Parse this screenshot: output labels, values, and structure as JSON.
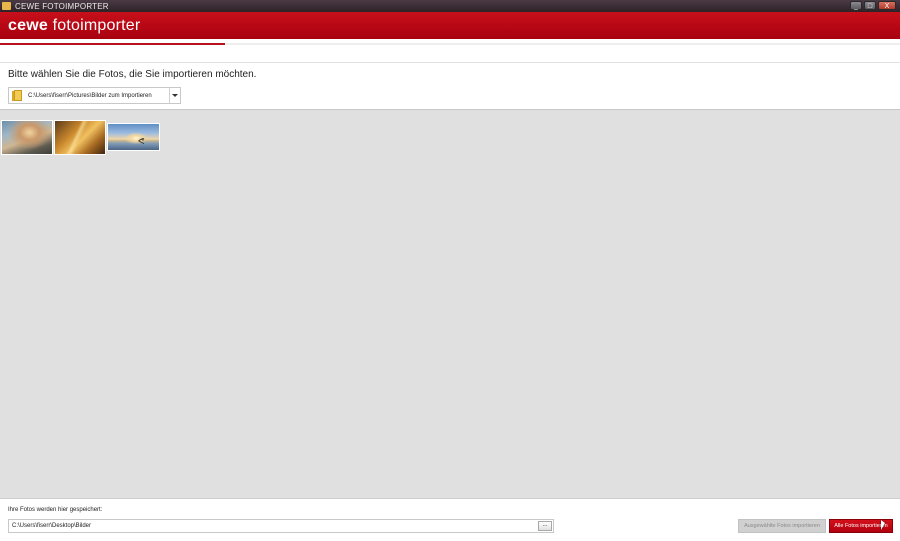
{
  "window": {
    "title": "CEWE FOTOIMPORTER",
    "controls": [
      "_",
      "□",
      "X"
    ]
  },
  "brand": {
    "bold": "cewe",
    "light": "fotoimporter",
    "accent_color": "#b8101c"
  },
  "import_progress": 0.25,
  "source": {
    "prompt": "Bitte wählen Sie die Fotos, die Sie importieren möchten.",
    "folder_path": "C:\\Users\\fiserr\\Pictures\\Bilder zum Importieren"
  },
  "thumbnails": [
    {
      "icon": "photo-reflection"
    },
    {
      "icon": "photo-amber-abstract"
    },
    {
      "icon": "photo-sunset-sea-with-gull"
    }
  ],
  "destination": {
    "label": "Ihre Fotos werden hier gespeichert:",
    "path": "C:\\Users\\fiserr\\Desktop\\Bilder",
    "browse_label": "..."
  },
  "actions": {
    "import_selected_label": "Ausgewählte Fotos importieren",
    "import_all_label": "Alle Fotos importieren"
  }
}
